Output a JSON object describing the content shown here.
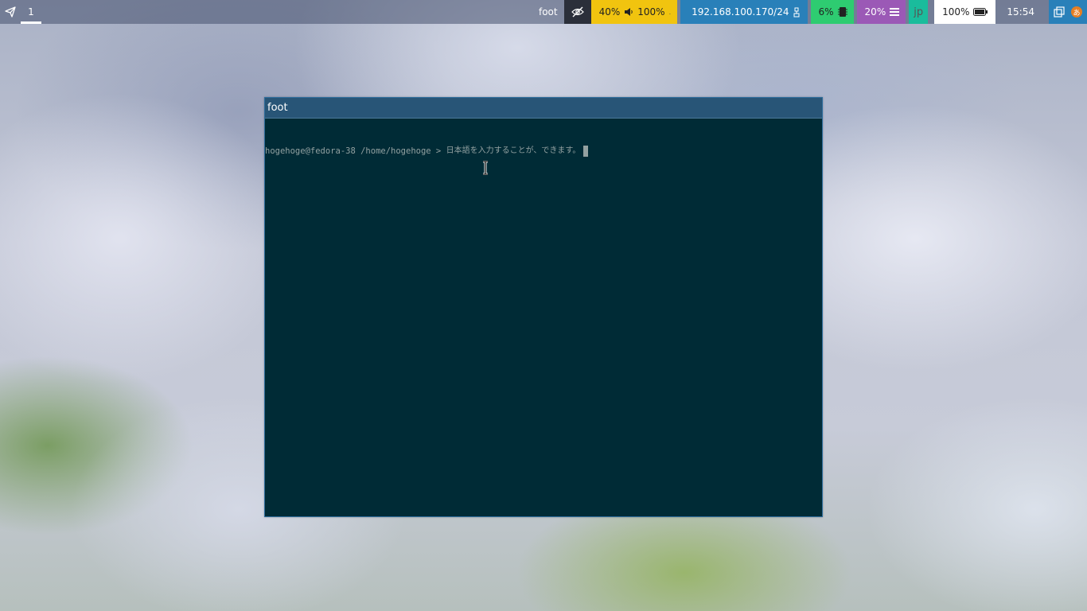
{
  "topbar": {
    "workspace": "1",
    "window_title": "foot",
    "audio": {
      "brightness": "40%",
      "volume": "100%"
    },
    "network": {
      "ip": "192.168.100.170/24"
    },
    "cpu": "6%",
    "memory": "20%",
    "keyboard_layout": "jp",
    "battery": "100%",
    "clock": "15:54",
    "ime_label": "あ",
    "colors": {
      "audio": "#f1c40f",
      "network": "#2980b9",
      "cpu": "#2ecc71",
      "memory": "#9b59b6",
      "language": "#1abc9c"
    }
  },
  "window": {
    "title": "foot",
    "prompt": "hogehoge@fedora-38 /home/hogehoge > ",
    "input_text": "日本語を入力することが、できます。",
    "background": "#002b36",
    "title_bar_color": "#285577"
  }
}
